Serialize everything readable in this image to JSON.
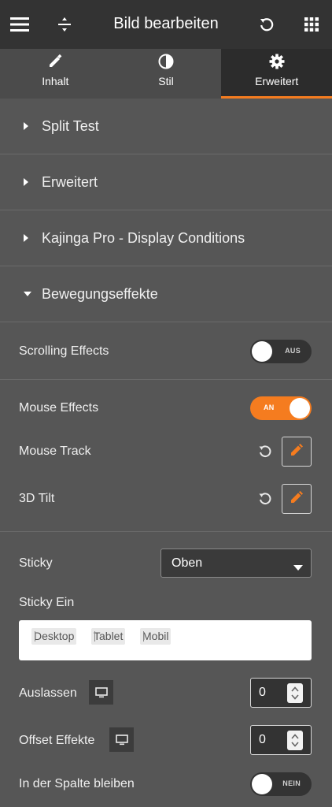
{
  "header": {
    "title": "Bild bearbeiten",
    "icons": [
      "hamburger-icon",
      "columns-icon",
      "history-icon",
      "grid-icon"
    ]
  },
  "tabs": [
    {
      "label": "Inhalt",
      "icon": "pencil-icon",
      "active": false
    },
    {
      "label": "Stil",
      "icon": "contrast-icon",
      "active": false
    },
    {
      "label": "Erweitert",
      "icon": "gear-icon",
      "active": true
    }
  ],
  "sections": [
    {
      "label": "Split Test",
      "expanded": false
    },
    {
      "label": "Erweitert",
      "expanded": false
    },
    {
      "label": "Kajinga Pro - Display Conditions",
      "expanded": false
    },
    {
      "label": "Bewegungseffekte",
      "expanded": true
    }
  ],
  "controls": {
    "scrolling_effects": {
      "label": "Scrolling Effects",
      "toggle_text": "AUS",
      "on": false
    },
    "mouse_effects": {
      "label": "Mouse Effects",
      "toggle_text": "AN",
      "on": true
    },
    "mouse_track": {
      "label": "Mouse Track"
    },
    "tilt_3d": {
      "label": "3D Tilt"
    },
    "sticky": {
      "label": "Sticky",
      "value": "Oben"
    },
    "sticky_on": {
      "label": "Sticky Ein",
      "chips": [
        "Desktop",
        "Tablet",
        "Mobil"
      ]
    },
    "auslassen": {
      "label": "Auslassen",
      "value": "0"
    },
    "offset": {
      "label": "Offset Effekte",
      "value": "0"
    },
    "in_column": {
      "label": "In der Spalte bleiben",
      "toggle_text": "NEIN",
      "on": false
    }
  },
  "colors": {
    "accent": "#f57c1f",
    "panel": "#565656",
    "header": "#333333"
  }
}
